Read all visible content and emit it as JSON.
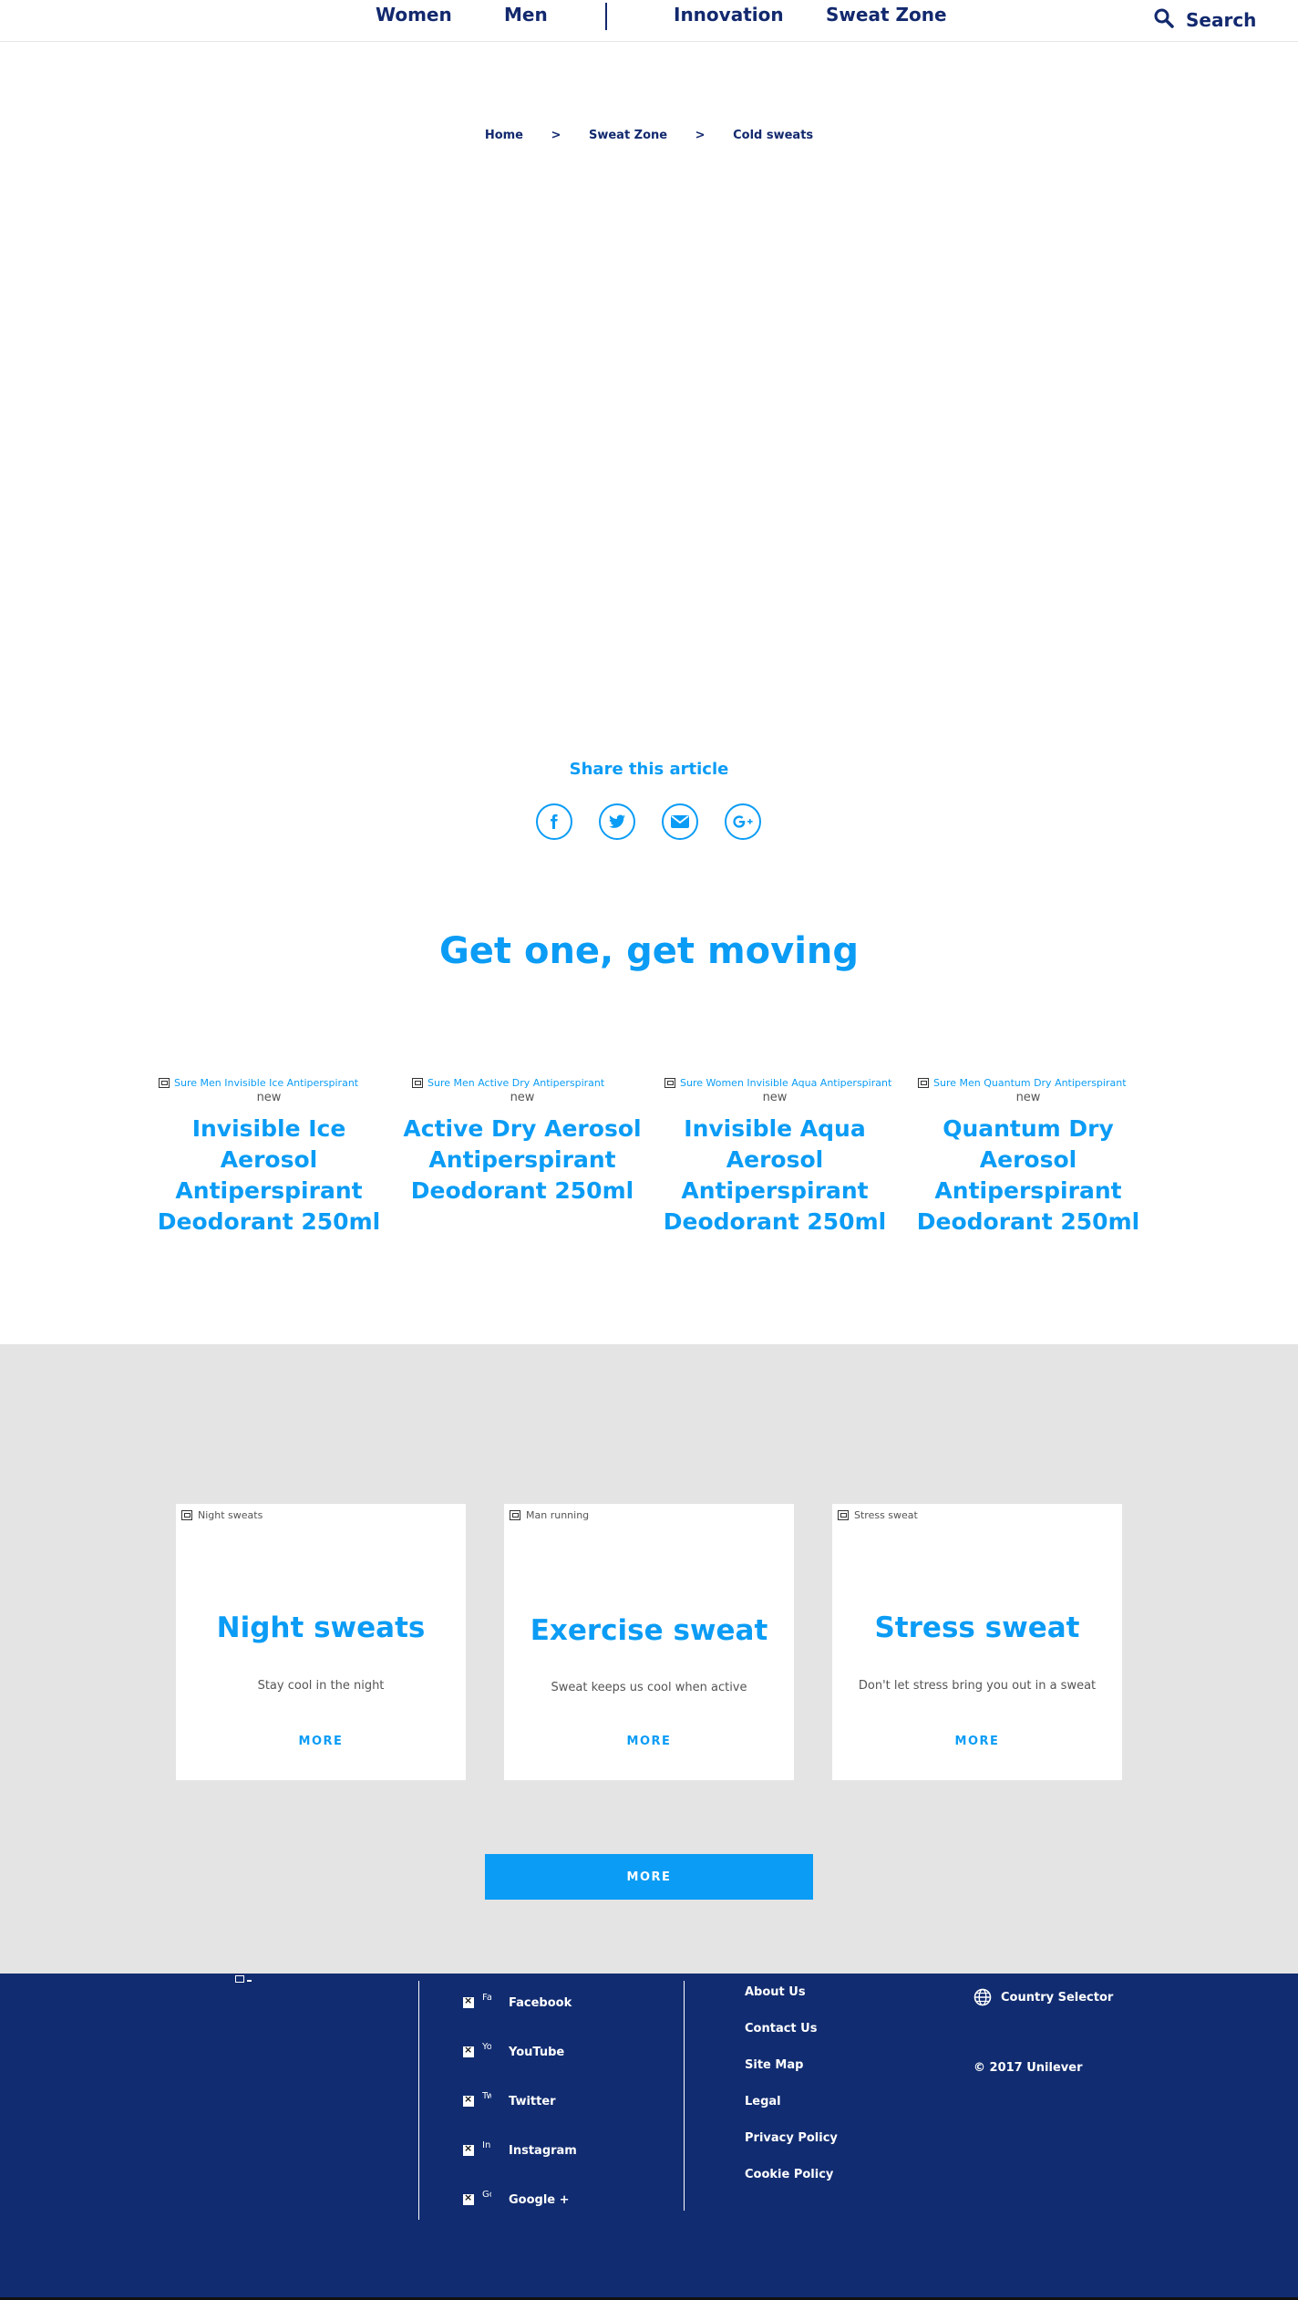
{
  "header": {
    "nav": [
      "Women",
      "Men",
      "Innovation",
      "Sweat Zone"
    ],
    "search_label": "Search"
  },
  "breadcrumb": [
    "Home",
    "Sweat Zone",
    "Cold sweats"
  ],
  "breadcrumb_separator": ">",
  "share": {
    "title": "Share this article",
    "icons": [
      "facebook-icon",
      "twitter-icon",
      "email-icon",
      "google-plus-icon"
    ]
  },
  "products_section": {
    "title": "Get one, get moving",
    "items": [
      {
        "image_alt": "Sure Men Invisible Ice Antiperspirant",
        "badge": "new",
        "name": "Invisible Ice Aerosol Antiperspirant Deodorant 250ml"
      },
      {
        "image_alt": "Sure Men Active Dry Antiperspirant",
        "badge": "new",
        "name": "Active Dry Aerosol Antiperspirant Deodorant 250ml"
      },
      {
        "image_alt": "Sure Women Invisible Aqua Antiperspirant",
        "badge": "new",
        "name": "Invisible Aqua Aerosol Antiperspirant Deodorant 250ml"
      },
      {
        "image_alt": "Sure Men Quantum Dry Antiperspirant",
        "badge": "new",
        "name": "Quantum Dry Aerosol Antiperspirant Deodorant 250ml"
      }
    ]
  },
  "articles": {
    "cards": [
      {
        "image_alt": "Night sweats",
        "title": "Night sweats",
        "description": "Stay cool in the night",
        "link": "MORE"
      },
      {
        "image_alt": "Man running",
        "title": "Exercise sweat",
        "description": "Sweat keeps us cool when active",
        "link": "MORE"
      },
      {
        "image_alt": "Stress sweat",
        "title": "Stress sweat",
        "description": "Don't let stress bring you out in a sweat",
        "link": "MORE"
      }
    ],
    "more_button": "MORE"
  },
  "footer": {
    "social": [
      {
        "alt": "Fa...",
        "label": "Facebook"
      },
      {
        "alt": "Yo...",
        "label": "YouTube"
      },
      {
        "alt": "Tw...",
        "label": "Twitter"
      },
      {
        "alt": "In...",
        "label": "Instagram"
      },
      {
        "alt": "Go...",
        "label": "Google +"
      }
    ],
    "links": [
      "About Us",
      "Contact Us",
      "Site Map",
      "Legal",
      "Privacy Policy",
      "Cookie Policy"
    ],
    "country_selector": "Country Selector",
    "copyright": "© 2017 Unilever"
  },
  "colors": {
    "brand_navy": "#12296e",
    "accent_blue": "#0b9cf5",
    "footer_bg": "#112c70",
    "band_grey": "#e4e4e4"
  }
}
